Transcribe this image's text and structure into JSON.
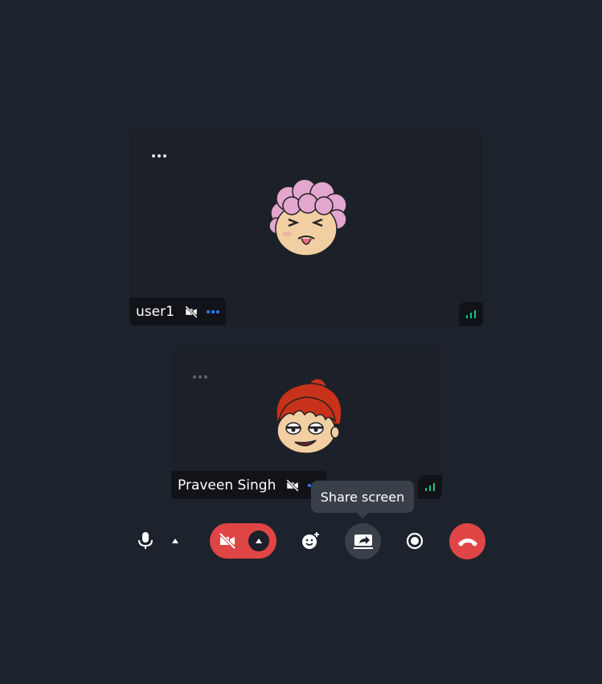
{
  "participants": [
    {
      "name": "user1",
      "menu_icon": "more-horizontal-icon",
      "camera_icon": "camera-off-icon",
      "signal_icon": "signal-strength-icon"
    },
    {
      "name": "Praveen Singh",
      "menu_icon": "more-horizontal-icon",
      "camera_icon": "camera-off-icon",
      "signal_icon": "signal-strength-icon"
    }
  ],
  "toolbar": {
    "mic_icon": "microphone-icon",
    "mic_options_icon": "caret-up-icon",
    "camera_icon": "camera-off-icon",
    "camera_options_icon": "caret-up-icon",
    "reaction_icon": "emoji-add-icon",
    "share_icon": "screen-share-icon",
    "record_icon": "record-icon",
    "hangup_icon": "phone-hangup-icon"
  },
  "tooltip": {
    "label": "Share screen"
  },
  "colors": {
    "background": "#1d232c",
    "tile": "#1b2029",
    "danger": "#e04545",
    "accent_blue": "#2e7cf6",
    "signal_green": "#19c37d"
  }
}
